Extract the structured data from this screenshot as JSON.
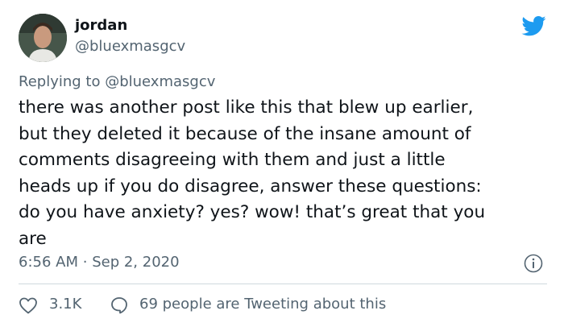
{
  "author": {
    "display_name": "jordan",
    "handle": "@bluexmasgcv"
  },
  "reply_context": {
    "prefix": "Replying to",
    "mention": "@bluexmasgcv"
  },
  "tweet": {
    "text": "there was another post like this that blew up earlier,\nbut they deleted it because of the insane amount of\ncomments disagreeing with them and just a little\nheads up if you do disagree, answer these questions:\ndo you have anxiety? yes? wow! that’s great that you\nare",
    "time": "6:56 AM",
    "separator": "·",
    "date": "Sep 2, 2020"
  },
  "stats": {
    "likes": "3.1K",
    "replies_label": "69 people are Tweeting about this"
  },
  "icons": {
    "brand": "twitter-bird-icon",
    "info": "info-icon",
    "like": "heart-icon",
    "reply": "speech-bubble-icon"
  },
  "colors": {
    "brand_blue": "#1d9bf0",
    "text_primary": "#0f1419",
    "text_secondary": "#536471",
    "divider": "#cfd9de"
  }
}
